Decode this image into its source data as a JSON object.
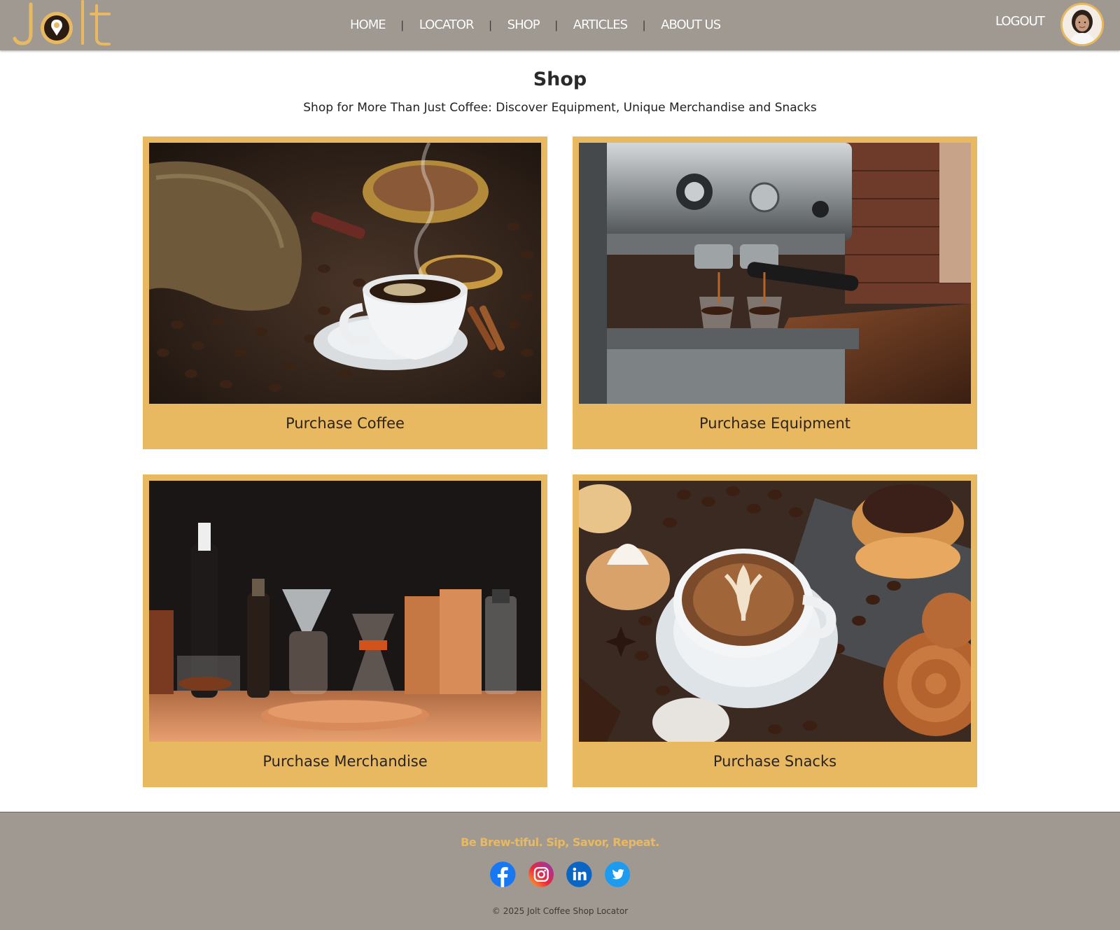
{
  "header": {
    "logo_text": "Jolt",
    "nav": [
      {
        "label": "HOME"
      },
      {
        "label": "LOCATOR"
      },
      {
        "label": "SHOP"
      },
      {
        "label": "ARTICLES"
      },
      {
        "label": "ABOUT US"
      }
    ],
    "nav_separator": "|",
    "logout_label": "LOGOUT",
    "avatar_icon": "user-avatar"
  },
  "main": {
    "title": "Shop",
    "subtitle": "Shop for More Than Just Coffee: Discover Equipment, Unique Merchandise and Snacks",
    "cards": [
      {
        "label": "Purchase Coffee",
        "image": "coffee-cup-beans-photo"
      },
      {
        "label": "Purchase Equipment",
        "image": "espresso-machine-photo"
      },
      {
        "label": "Purchase Merchandise",
        "image": "coffee-merchandise-photo"
      },
      {
        "label": "Purchase Snacks",
        "image": "latte-pastries-photo"
      }
    ]
  },
  "footer": {
    "tagline": "Be Brew-tiful. Sip, Savor, Repeat.",
    "socials": [
      {
        "name": "facebook",
        "icon": "facebook-icon"
      },
      {
        "name": "instagram",
        "icon": "instagram-icon"
      },
      {
        "name": "linkedin",
        "icon": "linkedin-icon"
      },
      {
        "name": "twitter",
        "icon": "twitter-icon"
      }
    ],
    "copyright": "© 2025 Jolt Coffee Shop Locator"
  },
  "colors": {
    "header_bg": "#a09992",
    "accent_gold": "#e8b960",
    "text_dark": "#2b2b2b"
  }
}
